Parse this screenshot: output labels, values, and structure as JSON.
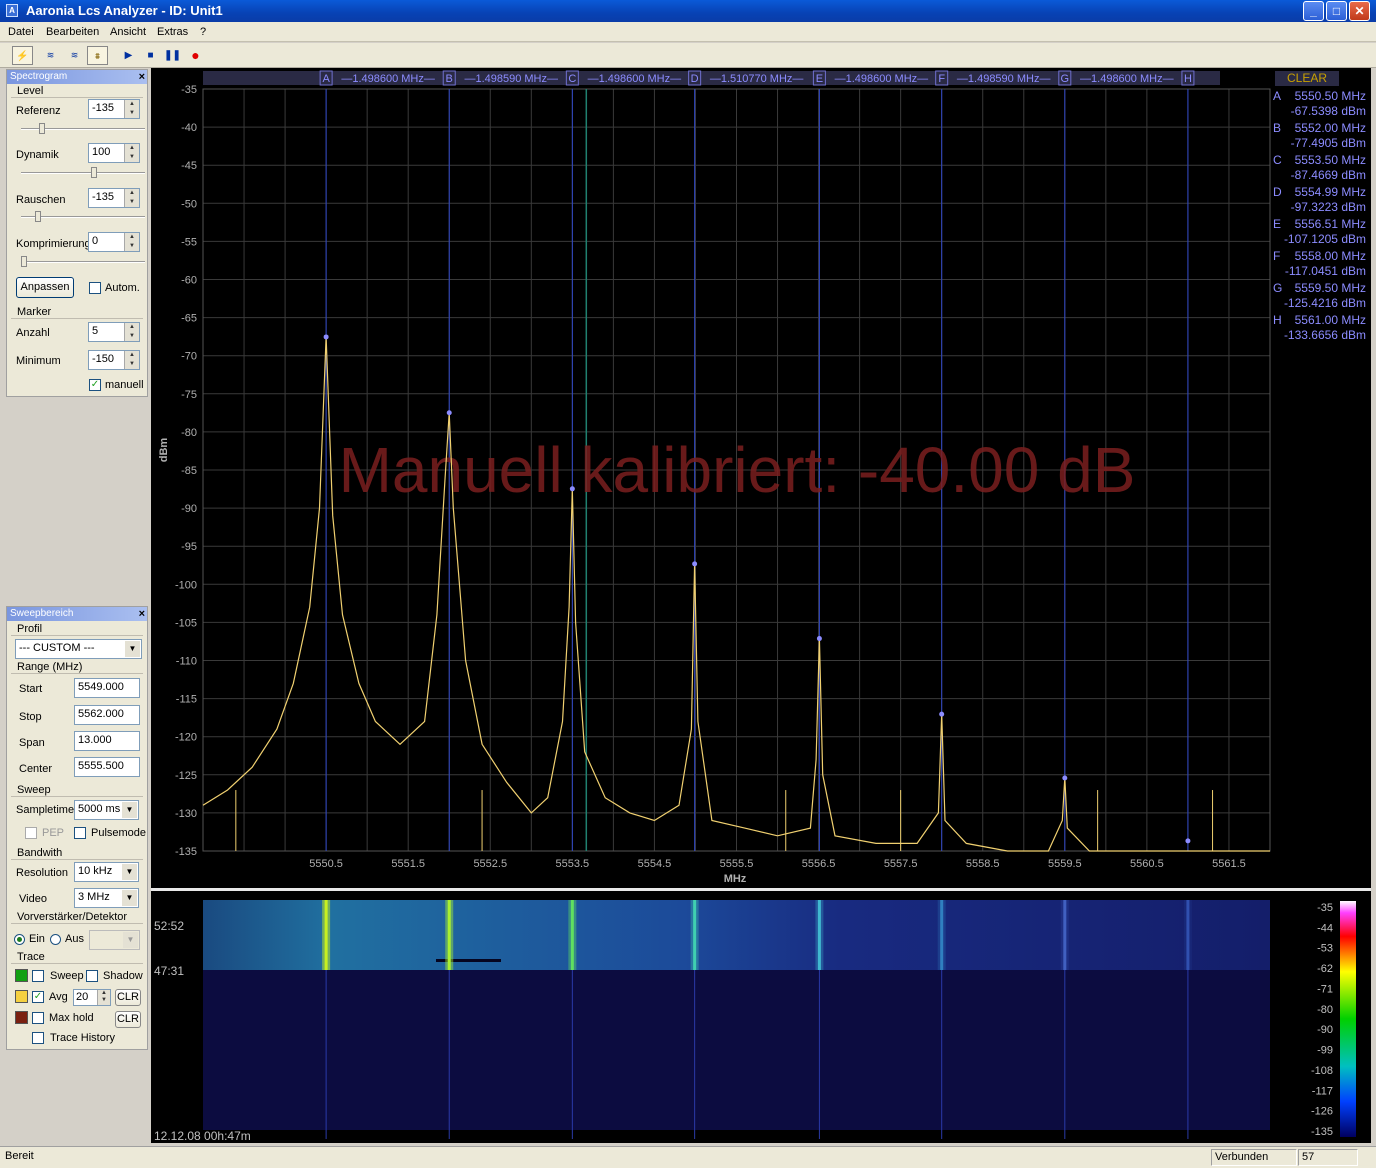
{
  "window": {
    "title": "Aaronia Lcs Analyzer - ID: Unit1",
    "controls": {
      "minimize": "_",
      "maximize": "□",
      "close": "✕"
    }
  },
  "menu": [
    "Datei",
    "Bearbeiten",
    "Ansicht",
    "Extras",
    "?"
  ],
  "toolbar_icons": [
    "connect-icon",
    "sweep-range-icon",
    "sweep-range-2-icon",
    "trace-icon",
    "play-icon",
    "stop-icon",
    "pause-icon",
    "record-icon"
  ],
  "spectrogram_panel": {
    "title": "Spectrogram",
    "level_group": "Level",
    "referenz_label": "Referenz",
    "referenz_value": "-135",
    "dynamik_label": "Dynamik",
    "dynamik_value": "100",
    "rauschen_label": "Rauschen",
    "rauschen_value": "-135",
    "komprimierung_label": "Komprimierung",
    "komprimierung_value": "0",
    "anpassen_button": "Anpassen",
    "autom_label": "Autom.",
    "marker_group": "Marker",
    "anzahl_label": "Anzahl",
    "anzahl_value": "5",
    "minimum_label": "Minimum",
    "minimum_value": "-150",
    "manuell_label": "manuell"
  },
  "sweep_panel": {
    "title": "Sweepbereich",
    "profil_group": "Profil",
    "profil_value": "--- CUSTOM ---",
    "range_group": "Range (MHz)",
    "start_label": "Start",
    "start_value": "5549.000",
    "stop_label": "Stop",
    "stop_value": "5562.000",
    "span_label": "Span",
    "span_value": "13.000",
    "center_label": "Center",
    "center_value": "5555.500",
    "sweep_group": "Sweep",
    "sampletime_label": "Sampletime",
    "sampletime_value": "5000 ms",
    "pep_label": "PEP",
    "pulsemode_label": "Pulsemode",
    "bandwith_group": "Bandwith",
    "resolution_label": "Resolution",
    "resolution_value": "10 kHz",
    "video_label": "Video",
    "video_value": "3 MHz",
    "preamp_group": "Vorverstärker/Detektor",
    "ein_label": "Ein",
    "aus_label": "Aus",
    "trace_group": "Trace",
    "sweep_label": "Sweep",
    "shadow_label": "Shadow",
    "avg_label": "Avg",
    "avg_value": "20",
    "clr_label": "CLR",
    "maxhold_label": "Max hold",
    "clr2_label": "CLR",
    "trace_history_label": "Trace History",
    "colors": {
      "sweep": "#12a012",
      "avg": "#f5d040",
      "maxhold": "#7a2010"
    }
  },
  "spectrum": {
    "clear_button": "CLEAR",
    "y_label": "dBm",
    "x_label": "MHz",
    "calibration_text": "Manuell kalibriert: -40.00 dB",
    "y_ticks": [
      "-35",
      "-40",
      "-45",
      "-50",
      "-55",
      "-60",
      "-65",
      "-70",
      "-75",
      "-80",
      "-85",
      "-90",
      "-95",
      "-100",
      "-105",
      "-110",
      "-115",
      "-120",
      "-125",
      "-130",
      "-135"
    ],
    "x_ticks": [
      "5550.5",
      "5551.5",
      "5552.5",
      "5553.5",
      "5554.5",
      "5555.5",
      "5556.5",
      "5557.5",
      "5558.5",
      "5559.5",
      "5560.5",
      "5561.5"
    ],
    "delta_bar": [
      {
        "letter": "A",
        "delta": "1.498600 MHz"
      },
      {
        "letter": "B",
        "delta": "1.498590 MHz"
      },
      {
        "letter": "C",
        "delta": "1.498600 MHz"
      },
      {
        "letter": "D",
        "delta": "1.510770 MHz"
      },
      {
        "letter": "E",
        "delta": "1.498600 MHz"
      },
      {
        "letter": "F",
        "delta": "1.498590 MHz"
      },
      {
        "letter": "G",
        "delta": "1.498600 MHz"
      },
      {
        "letter": "H",
        "delta": ""
      }
    ],
    "markers": [
      {
        "letter": "A",
        "freq": "5550.50 MHz",
        "level": "-67.5398 dBm"
      },
      {
        "letter": "B",
        "freq": "5552.00 MHz",
        "level": "-77.4905 dBm"
      },
      {
        "letter": "C",
        "freq": "5553.50 MHz",
        "level": "-87.4669 dBm"
      },
      {
        "letter": "D",
        "freq": "5554.99 MHz",
        "level": "-97.3223 dBm"
      },
      {
        "letter": "E",
        "freq": "5556.51 MHz",
        "level": "-107.1205 dBm"
      },
      {
        "letter": "F",
        "freq": "5558.00 MHz",
        "level": "-117.0451 dBm"
      },
      {
        "letter": "G",
        "freq": "5559.50 MHz",
        "level": "-125.4216 dBm"
      },
      {
        "letter": "H",
        "freq": "5561.00 MHz",
        "level": "-133.6656 dBm"
      }
    ]
  },
  "chart_data": {
    "type": "line",
    "xlabel": "MHz",
    "ylabel": "dBm",
    "xlim": [
      5549.0,
      5562.0
    ],
    "ylim": [
      -135,
      -35
    ],
    "grid": true,
    "series": [
      {
        "x": [
          5549.0,
          5549.3,
          5549.6,
          5549.9,
          5550.1,
          5550.3,
          5550.42,
          5550.5,
          5550.58,
          5550.7,
          5550.9,
          5551.1,
          5551.4,
          5551.7,
          5551.85,
          5551.95,
          5552.0,
          5552.05,
          5552.2,
          5552.4,
          5552.7,
          5553.0,
          5553.2,
          5553.38,
          5553.46,
          5553.5,
          5553.54,
          5553.65,
          5553.9,
          5554.2,
          5554.5,
          5554.8,
          5554.95,
          5554.99,
          5555.03,
          5555.2,
          5555.6,
          5556.0,
          5556.4,
          5556.47,
          5556.51,
          5556.55,
          5556.7,
          5557.2,
          5557.7,
          5557.96,
          5558.0,
          5558.04,
          5558.3,
          5558.8,
          5559.3,
          5559.47,
          5559.5,
          5559.53,
          5559.8,
          5560.4,
          5561.0,
          5561.5,
          5562.0
        ],
        "y": [
          -129,
          -127,
          -124,
          -119,
          -113,
          -103,
          -90,
          -67.5,
          -91,
          -104,
          -113,
          -118,
          -121,
          -118,
          -104,
          -86,
          -77.5,
          -90,
          -110,
          -121,
          -126,
          -130,
          -128,
          -118,
          -103,
          -87.5,
          -105,
          -122,
          -128,
          -130,
          -131,
          -129,
          -119,
          -97.3,
          -118,
          -131,
          -132,
          -133,
          -132,
          -123,
          -107.1,
          -125,
          -133,
          -134,
          -134,
          -130,
          -117.0,
          -131,
          -134,
          -135,
          -135,
          -131,
          -125.4,
          -132,
          -135,
          -135,
          -135,
          -135,
          -135
        ]
      }
    ]
  },
  "waterfall": {
    "time_labels": [
      "52:52",
      "47:31"
    ],
    "timestamp": "12.12.08 00h:47m",
    "colorbar_ticks": [
      "-35",
      "-44",
      "-53",
      "-62",
      "-71",
      "-80",
      "-90",
      "-99",
      "-108",
      "-117",
      "-126",
      "-135"
    ]
  },
  "statusbar": {
    "left": "Bereit",
    "connection": "Verbunden",
    "count": "57"
  }
}
